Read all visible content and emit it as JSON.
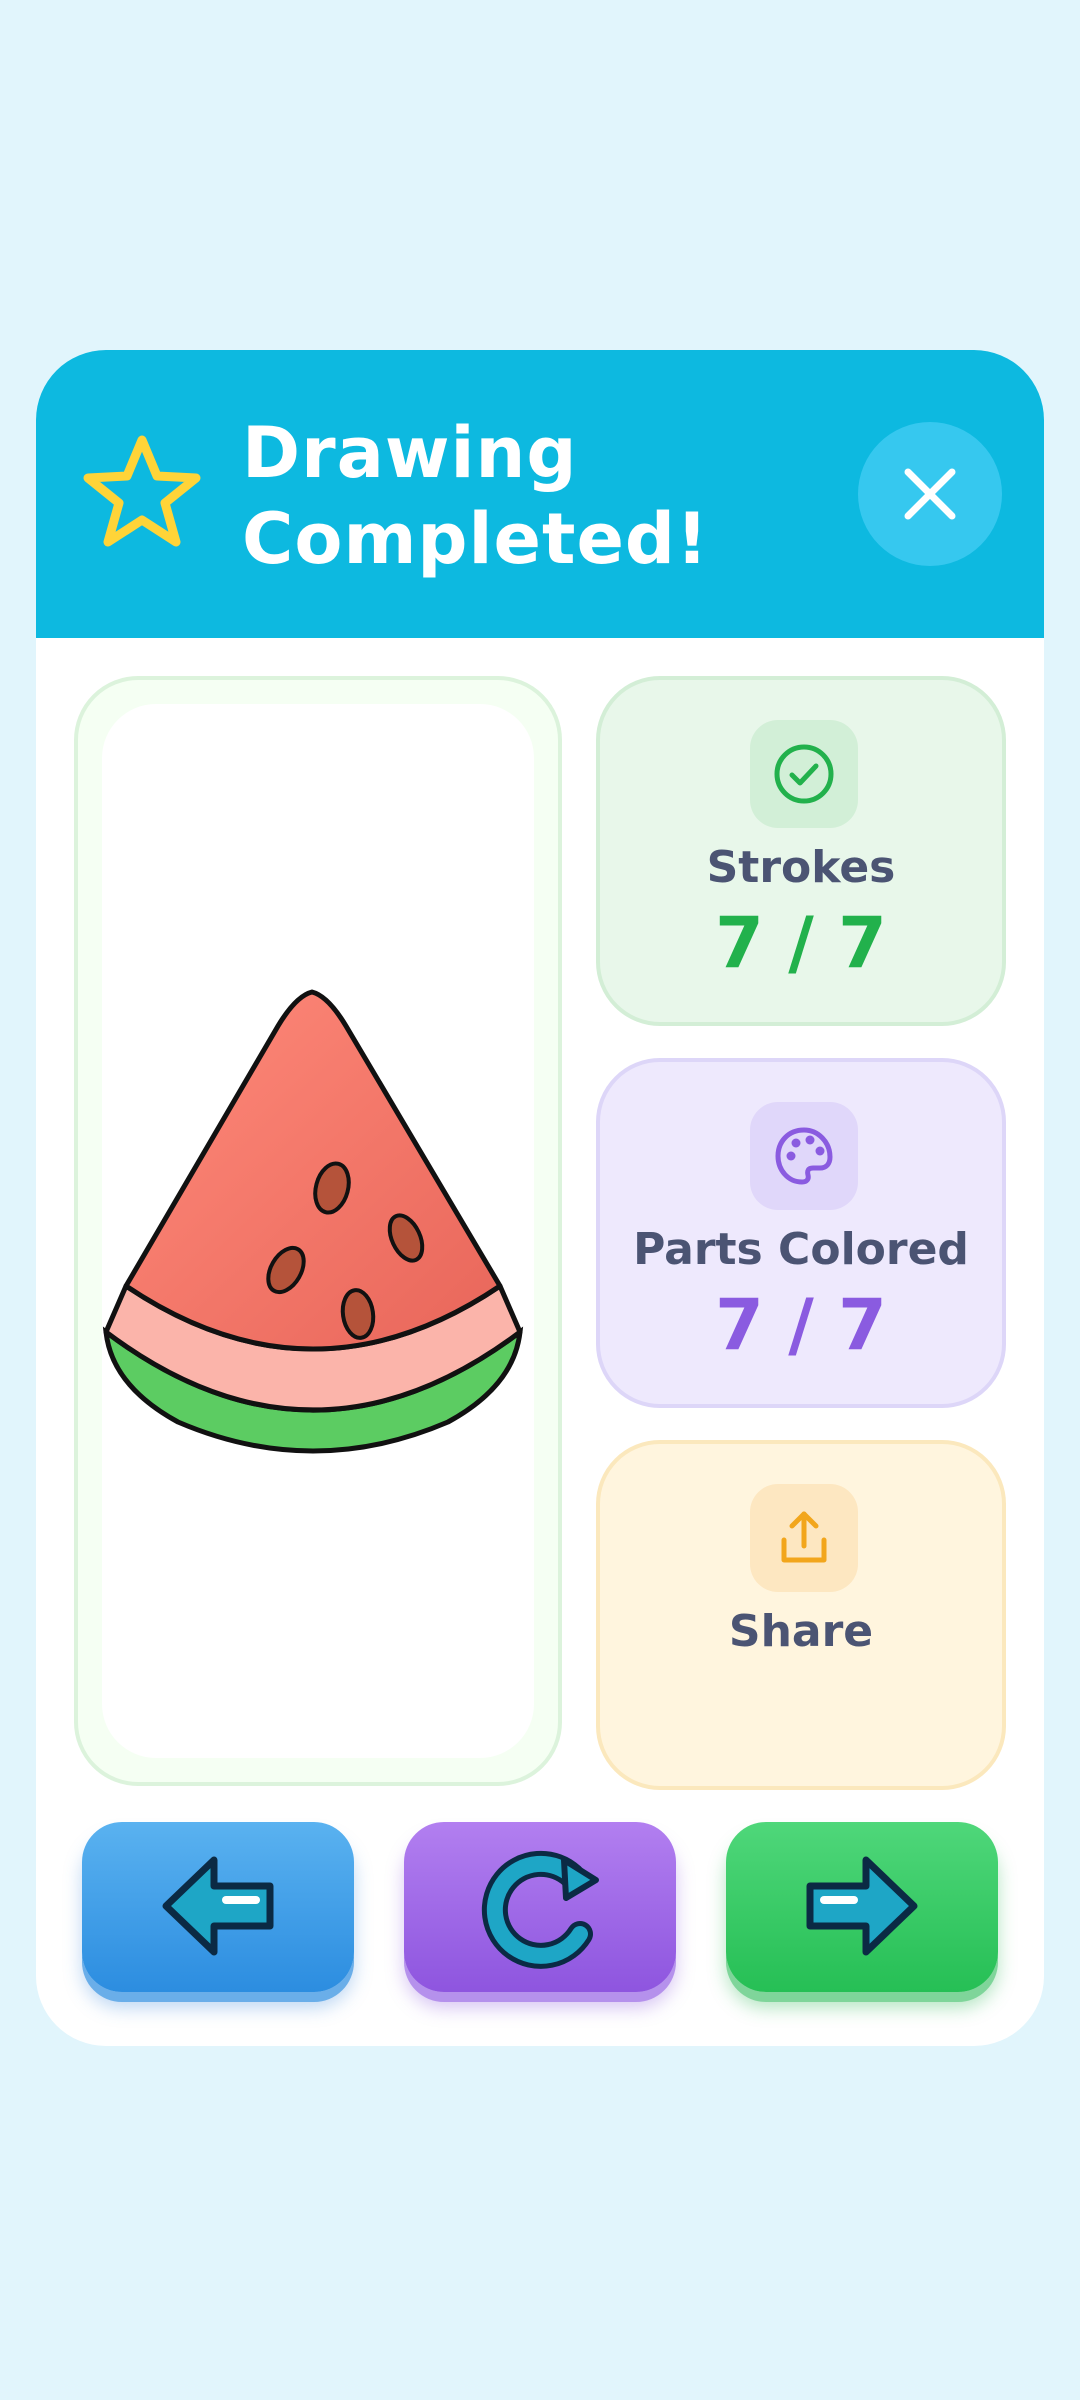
{
  "dialog": {
    "title_line1": "Drawing",
    "title_line2": "Completed!"
  },
  "stats": {
    "strokes_label": "Strokes",
    "strokes_value": "7 / 7",
    "parts_label": "Parts Colored",
    "parts_value": "7 / 7",
    "share_label": "Share"
  },
  "icons": {
    "header": "star-icon",
    "close": "close-icon",
    "strokes": "check-circle-icon",
    "parts": "palette-icon",
    "share": "share-icon",
    "back": "arrow-left-icon",
    "retry": "restart-icon",
    "next": "arrow-right-icon",
    "drawing": "watermelon-drawing"
  },
  "colors": {
    "header": "#0db9e0",
    "background": "#e1f5fc",
    "strokes_accent": "#22b14c",
    "parts_accent": "#8a5be0",
    "share_accent": "#f2a61c"
  }
}
